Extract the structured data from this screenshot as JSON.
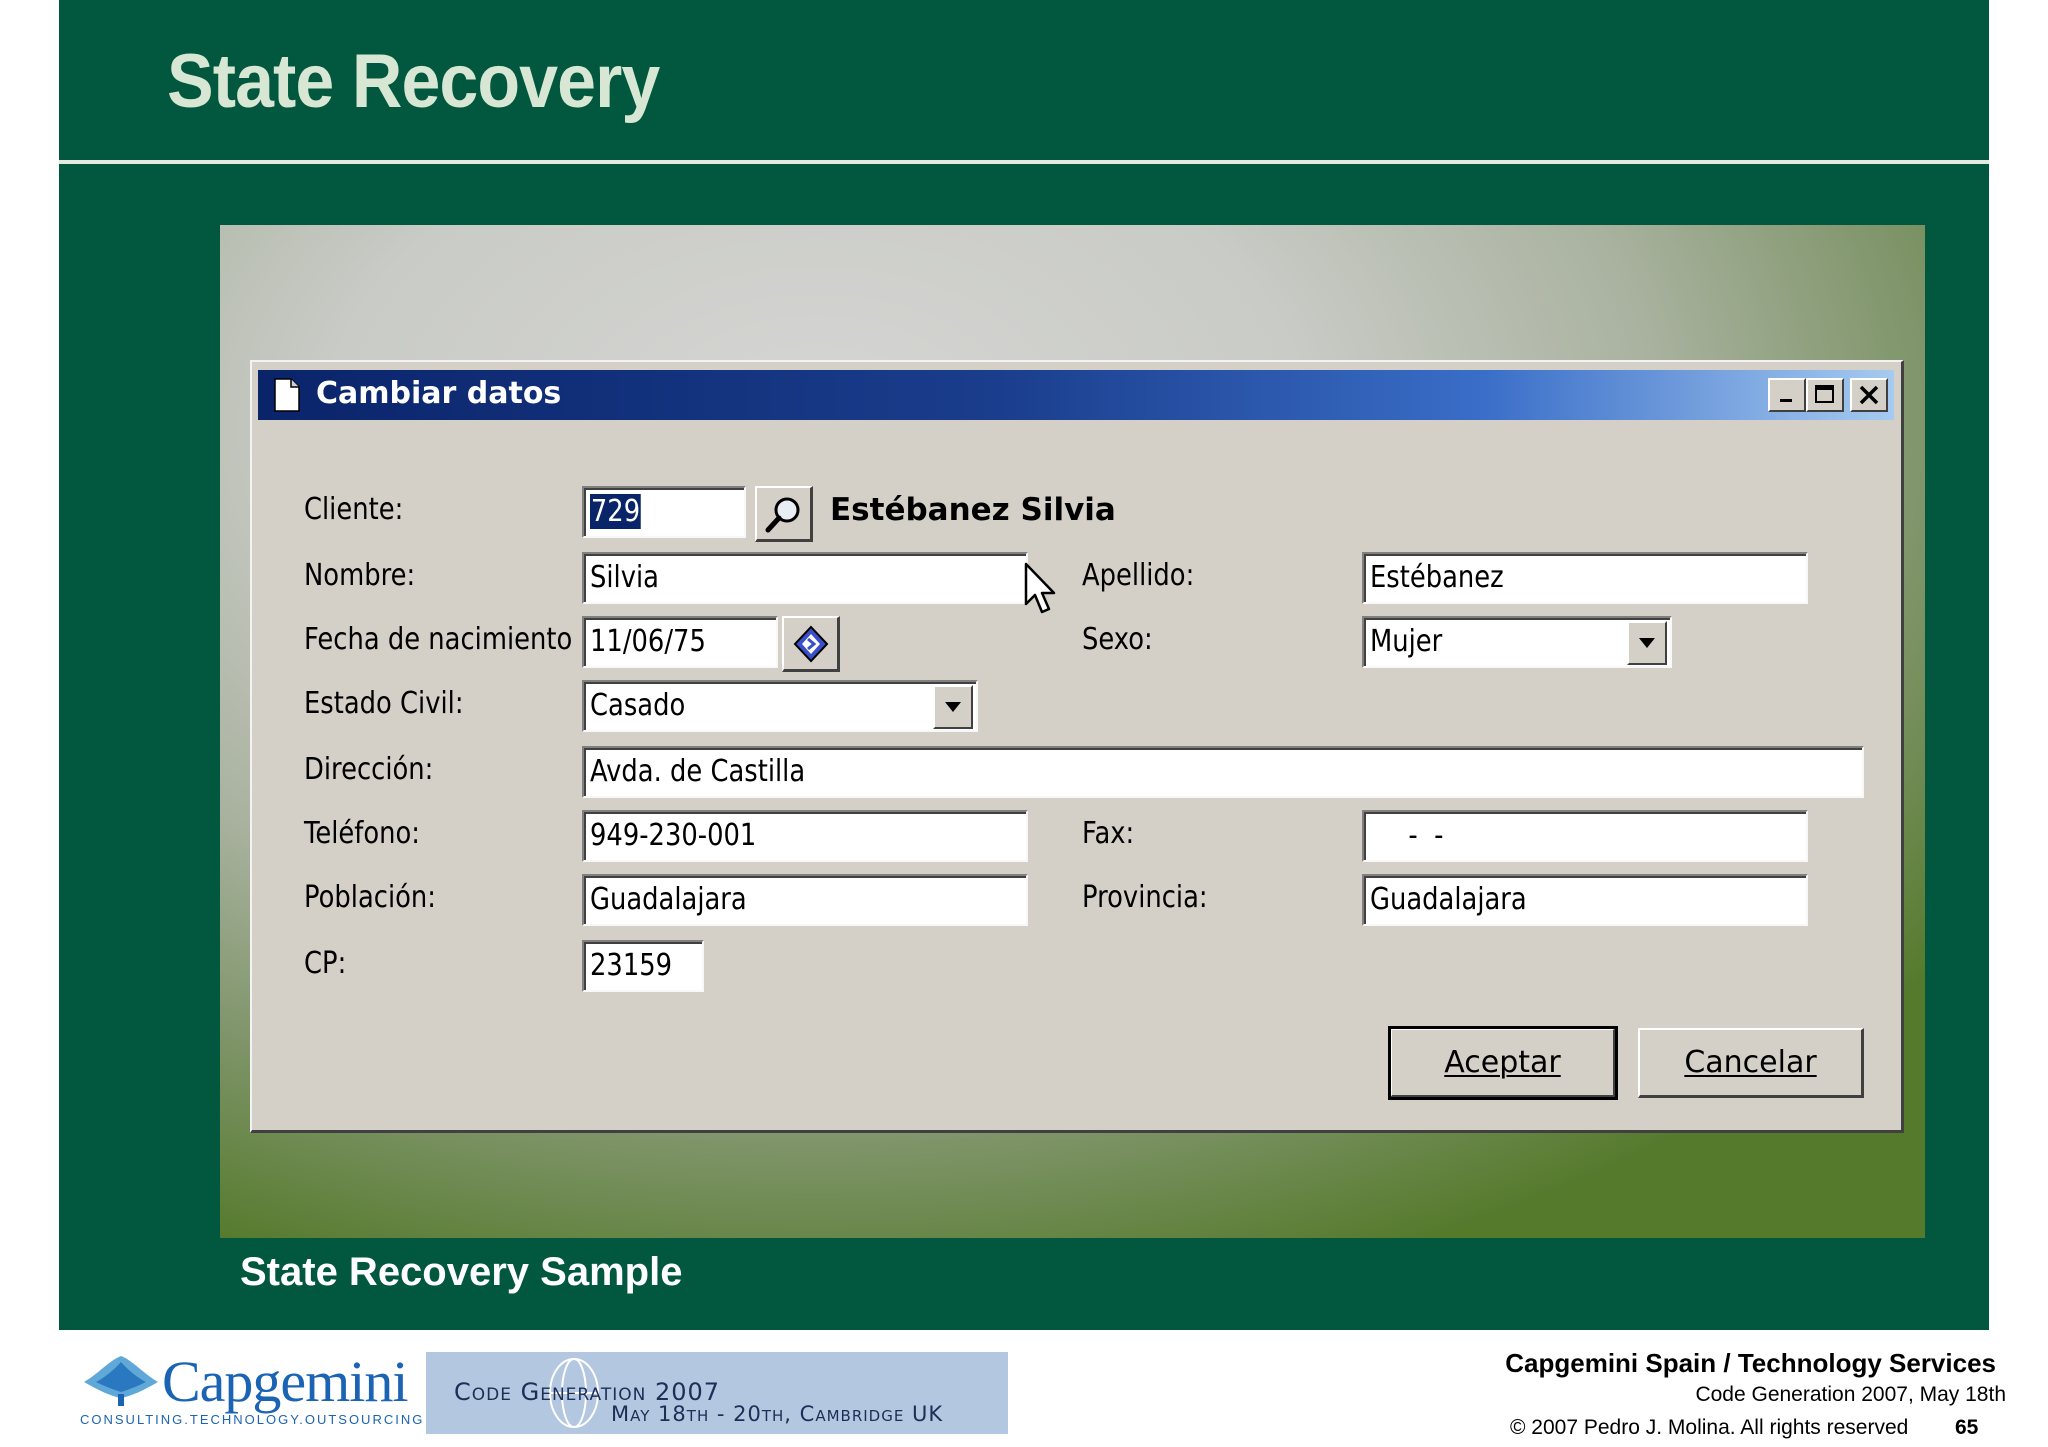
{
  "slide": {
    "title": "State Recovery",
    "caption": "State Recovery Sample"
  },
  "window": {
    "title": "Cambiar datos"
  },
  "form": {
    "cliente_label": "Cliente:",
    "cliente_value": "729",
    "cliente_name": "Estébanez Silvia",
    "nombre_label": "Nombre:",
    "nombre_value": "Silvia",
    "apellido_label": "Apellido:",
    "apellido_value": "Estébanez",
    "fecha_label": "Fecha de nacimiento",
    "fecha_value": "11/06/75",
    "sexo_label": "Sexo:",
    "sexo_value": "Mujer",
    "estado_label": "Estado Civil:",
    "estado_value": "Casado",
    "direccion_label": "Dirección:",
    "direccion_value": "Avda. de Castilla",
    "telefono_label": "Teléfono:",
    "telefono_value": "949-230-001",
    "fax_label": "Fax:",
    "fax_value": "  -  -",
    "poblacion_label": "Población:",
    "poblacion_value": "Guadalajara",
    "provincia_label": "Provincia:",
    "provincia_value": "Guadalajara",
    "cp_label": "CP:",
    "cp_value": "23159",
    "aceptar_label": "Aceptar",
    "cancelar_label": "Cancelar"
  },
  "footer": {
    "company": "Capgemini Spain / Technology Services",
    "event": "Code Generation 2007, May 18th",
    "copyright": "© 2007 Pedro J. Molina. All rights reserved",
    "page": "65",
    "logo_name": "Capgemini",
    "logo_tagline": "CONSULTING.TECHNOLOGY.OUTSOURCING",
    "banner_title": "Code Generation 2007",
    "banner_dates": "May 18th - 20th, Cambridge UK"
  },
  "colors": {
    "slide_green": "#02573f",
    "titlebar_blue": "#0a246a",
    "dialog_gray": "#d4d0c8"
  }
}
